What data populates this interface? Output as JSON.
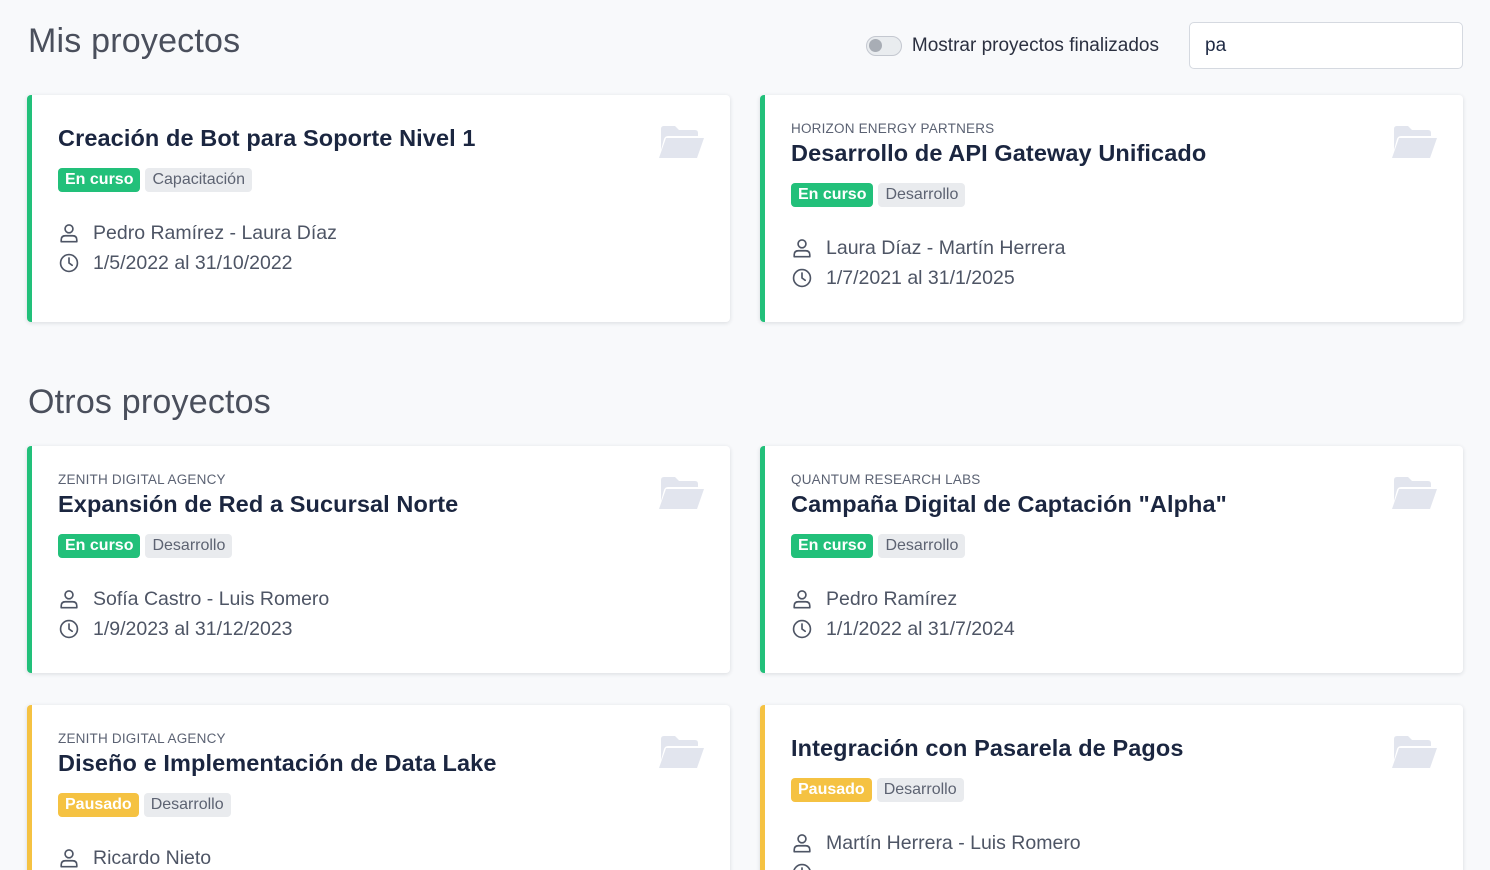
{
  "sections": {
    "mine": "Mis proyectos",
    "others": "Otros proyectos"
  },
  "toolbar": {
    "toggle_label": "Mostrar proyectos finalizados",
    "search_value": "pa"
  },
  "colors": {
    "active": "#22c07a",
    "paused": "#f5c242"
  },
  "cards": [
    {
      "client": "",
      "title": "Creación de Bot para Soporte Nivel 1",
      "status": "En curso",
      "category": "Capacitación",
      "people": "Pedro Ramírez - Laura Díaz",
      "dates": "1/5/2022 al 31/10/2022"
    },
    {
      "client": "Horizon Energy Partners",
      "title": "Desarrollo de API Gateway Unificado",
      "status": "En curso",
      "category": "Desarrollo",
      "people": "Laura Díaz - Martín Herrera",
      "dates": "1/7/2021 al 31/1/2025"
    },
    {
      "client": "Zenith Digital Agency",
      "title": "Expansión de Red a Sucursal Norte",
      "status": "En curso",
      "category": "Desarrollo",
      "people": "Sofía Castro - Luis Romero",
      "dates": "1/9/2023 al 31/12/2023"
    },
    {
      "client": "Quantum Research Labs",
      "title": "Campaña Digital de Captación \"Alpha\"",
      "status": "En curso",
      "category": "Desarrollo",
      "people": "Pedro Ramírez",
      "dates": "1/1/2022 al 31/7/2024"
    },
    {
      "client": "Zenith Digital Agency",
      "title": "Diseño e Implementación de Data Lake",
      "status": "Pausado",
      "category": "Desarrollo",
      "people": "Ricardo Nieto",
      "dates": ""
    },
    {
      "client": "",
      "title": "Integración con Pasarela de Pagos",
      "status": "Pausado",
      "category": "Desarrollo",
      "people": "Martín Herrera - Luis Romero",
      "dates": ""
    }
  ]
}
